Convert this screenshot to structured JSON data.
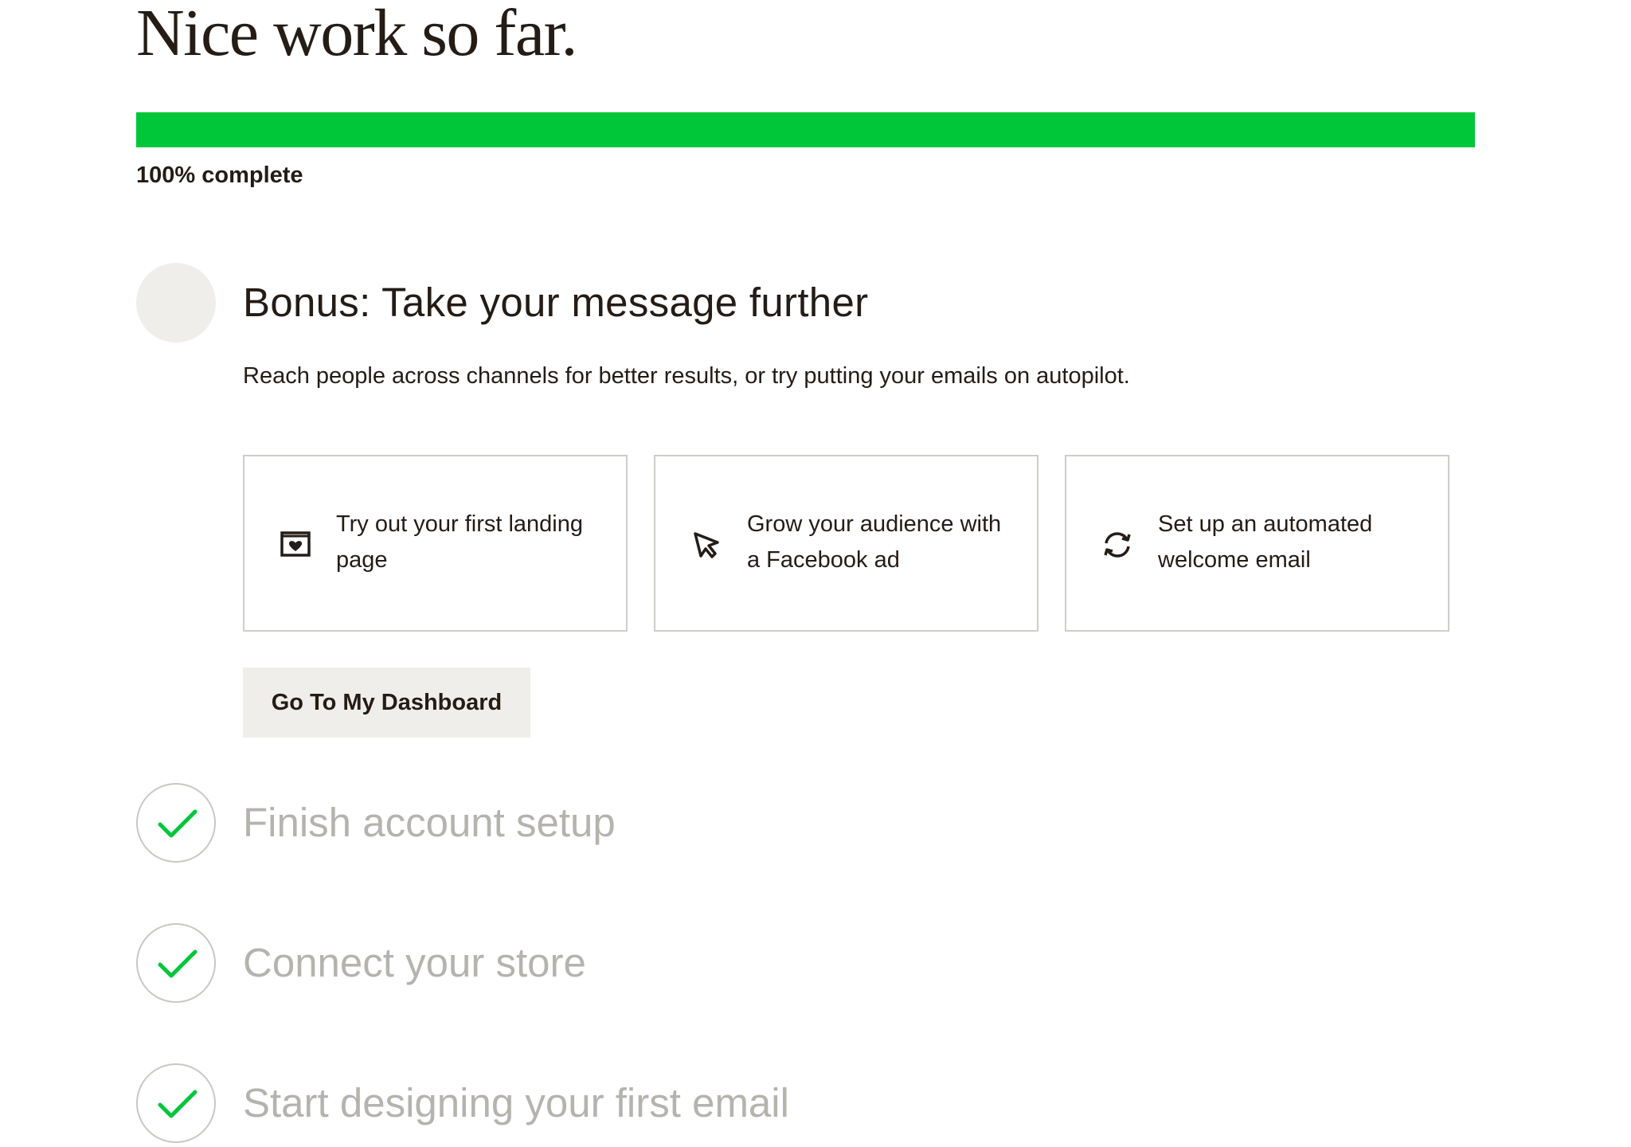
{
  "header": {
    "title": "Nice work so far."
  },
  "progress": {
    "percent": 100,
    "label": "100% complete",
    "fill_color": "#00c63a",
    "track_color": "#efeeea"
  },
  "bonus": {
    "title": "Bonus: Take your message further",
    "description": "Reach people across channels for better results, or try putting your emails on autopilot.",
    "cards": [
      {
        "icon": "landing-page-icon",
        "label": "Try out your first landing page"
      },
      {
        "icon": "cursor-icon",
        "label": "Grow your audience with a Facebook ad"
      },
      {
        "icon": "refresh-icon",
        "label": "Set up an automated welcome email"
      }
    ],
    "button_label": "Go To My Dashboard"
  },
  "steps": [
    {
      "label": "Finish account setup",
      "status": "complete",
      "icon": "check-icon"
    },
    {
      "label": "Connect your store",
      "status": "complete",
      "icon": "check-icon"
    },
    {
      "label": "Start designing your first email",
      "status": "complete",
      "icon": "check-icon"
    }
  ],
  "colors": {
    "accent_green": "#00c63a",
    "text_dark": "#241c15",
    "text_muted": "#b5b3ae"
  }
}
